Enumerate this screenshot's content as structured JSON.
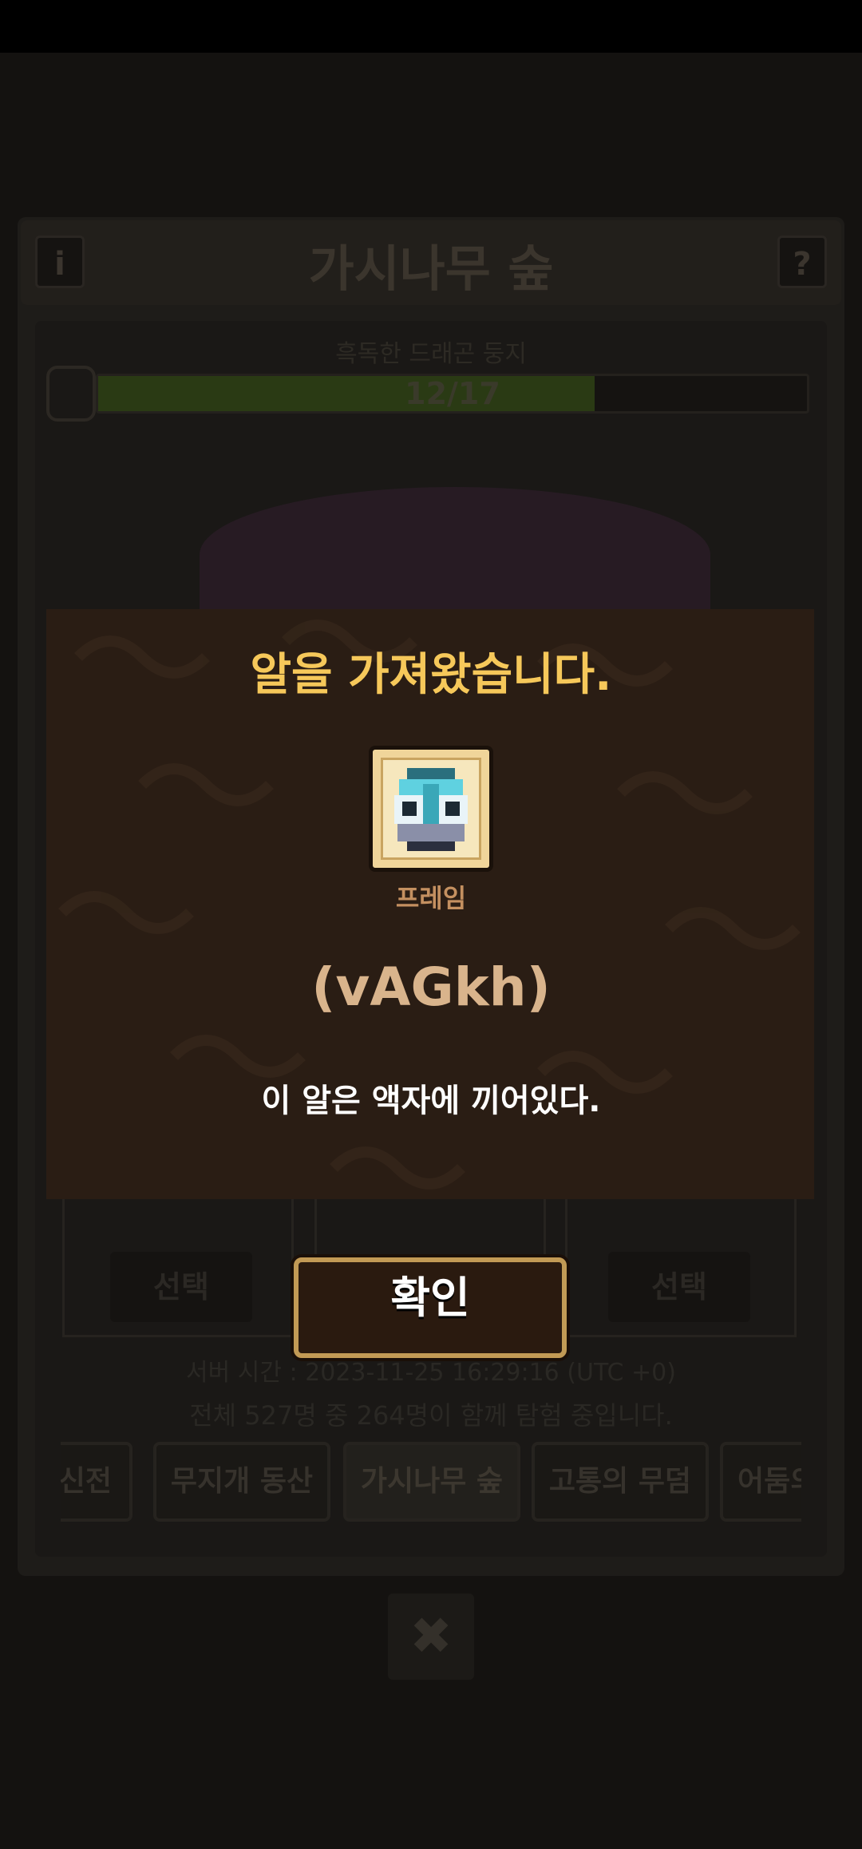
{
  "stage": {
    "title": "가시나무 숲",
    "info_icon": "info-icon",
    "help_label": "?",
    "boss_name": "흑독한 드래곤 둥지",
    "progress_text": "12/17",
    "progress_fraction": 0.7
  },
  "choices": {
    "select_left": "선택",
    "select_right": "선택"
  },
  "footer": {
    "server_time": "서버 시간 : 2023-11-25 16:29:16 (UTC +0)",
    "participants": "전체 527명 중 264명이 함께 탐험 중입니다."
  },
  "tabs": [
    {
      "label": "신전"
    },
    {
      "label": "무지개 동산"
    },
    {
      "label": "가시나무 숲"
    },
    {
      "label": "고통의 무덤"
    },
    {
      "label": "어둠의"
    }
  ],
  "close_icon": "close-icon",
  "modal": {
    "title": "알을 가져왔습니다.",
    "item_icon": "egg-frame-icon",
    "item_label": "프레임",
    "code": "(vAGkh)",
    "description": "이 알은 액자에 끼어있다.",
    "confirm_label": "확인"
  },
  "colors": {
    "modal_bg": "#2a1d14",
    "title_gold": "#f6c85a",
    "button_border": "#c29a55"
  }
}
